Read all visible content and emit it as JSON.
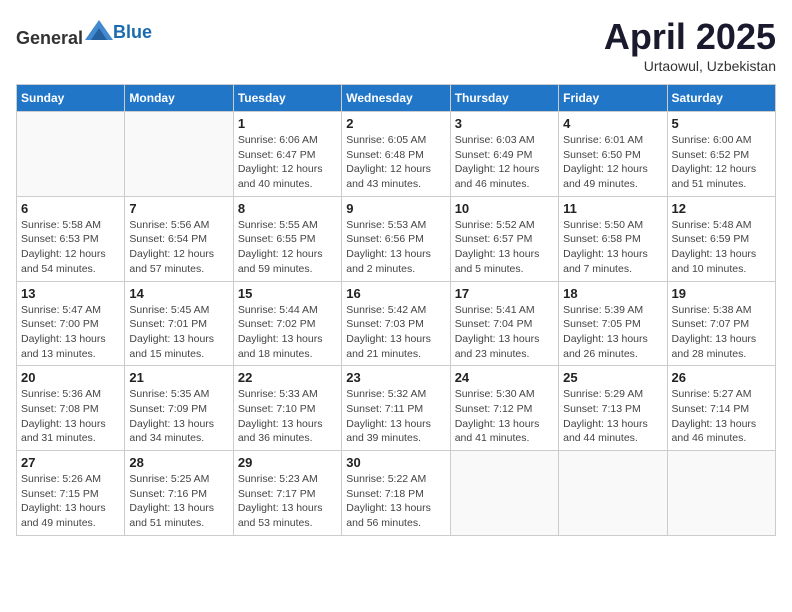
{
  "header": {
    "logo_general": "General",
    "logo_blue": "Blue",
    "month_title": "April 2025",
    "location": "Urtaowul, Uzbekistan"
  },
  "weekdays": [
    "Sunday",
    "Monday",
    "Tuesday",
    "Wednesday",
    "Thursday",
    "Friday",
    "Saturday"
  ],
  "weeks": [
    [
      {
        "day": "",
        "info": ""
      },
      {
        "day": "",
        "info": ""
      },
      {
        "day": "1",
        "info": "Sunrise: 6:06 AM\nSunset: 6:47 PM\nDaylight: 12 hours and 40 minutes."
      },
      {
        "day": "2",
        "info": "Sunrise: 6:05 AM\nSunset: 6:48 PM\nDaylight: 12 hours and 43 minutes."
      },
      {
        "day": "3",
        "info": "Sunrise: 6:03 AM\nSunset: 6:49 PM\nDaylight: 12 hours and 46 minutes."
      },
      {
        "day": "4",
        "info": "Sunrise: 6:01 AM\nSunset: 6:50 PM\nDaylight: 12 hours and 49 minutes."
      },
      {
        "day": "5",
        "info": "Sunrise: 6:00 AM\nSunset: 6:52 PM\nDaylight: 12 hours and 51 minutes."
      }
    ],
    [
      {
        "day": "6",
        "info": "Sunrise: 5:58 AM\nSunset: 6:53 PM\nDaylight: 12 hours and 54 minutes."
      },
      {
        "day": "7",
        "info": "Sunrise: 5:56 AM\nSunset: 6:54 PM\nDaylight: 12 hours and 57 minutes."
      },
      {
        "day": "8",
        "info": "Sunrise: 5:55 AM\nSunset: 6:55 PM\nDaylight: 12 hours and 59 minutes."
      },
      {
        "day": "9",
        "info": "Sunrise: 5:53 AM\nSunset: 6:56 PM\nDaylight: 13 hours and 2 minutes."
      },
      {
        "day": "10",
        "info": "Sunrise: 5:52 AM\nSunset: 6:57 PM\nDaylight: 13 hours and 5 minutes."
      },
      {
        "day": "11",
        "info": "Sunrise: 5:50 AM\nSunset: 6:58 PM\nDaylight: 13 hours and 7 minutes."
      },
      {
        "day": "12",
        "info": "Sunrise: 5:48 AM\nSunset: 6:59 PM\nDaylight: 13 hours and 10 minutes."
      }
    ],
    [
      {
        "day": "13",
        "info": "Sunrise: 5:47 AM\nSunset: 7:00 PM\nDaylight: 13 hours and 13 minutes."
      },
      {
        "day": "14",
        "info": "Sunrise: 5:45 AM\nSunset: 7:01 PM\nDaylight: 13 hours and 15 minutes."
      },
      {
        "day": "15",
        "info": "Sunrise: 5:44 AM\nSunset: 7:02 PM\nDaylight: 13 hours and 18 minutes."
      },
      {
        "day": "16",
        "info": "Sunrise: 5:42 AM\nSunset: 7:03 PM\nDaylight: 13 hours and 21 minutes."
      },
      {
        "day": "17",
        "info": "Sunrise: 5:41 AM\nSunset: 7:04 PM\nDaylight: 13 hours and 23 minutes."
      },
      {
        "day": "18",
        "info": "Sunrise: 5:39 AM\nSunset: 7:05 PM\nDaylight: 13 hours and 26 minutes."
      },
      {
        "day": "19",
        "info": "Sunrise: 5:38 AM\nSunset: 7:07 PM\nDaylight: 13 hours and 28 minutes."
      }
    ],
    [
      {
        "day": "20",
        "info": "Sunrise: 5:36 AM\nSunset: 7:08 PM\nDaylight: 13 hours and 31 minutes."
      },
      {
        "day": "21",
        "info": "Sunrise: 5:35 AM\nSunset: 7:09 PM\nDaylight: 13 hours and 34 minutes."
      },
      {
        "day": "22",
        "info": "Sunrise: 5:33 AM\nSunset: 7:10 PM\nDaylight: 13 hours and 36 minutes."
      },
      {
        "day": "23",
        "info": "Sunrise: 5:32 AM\nSunset: 7:11 PM\nDaylight: 13 hours and 39 minutes."
      },
      {
        "day": "24",
        "info": "Sunrise: 5:30 AM\nSunset: 7:12 PM\nDaylight: 13 hours and 41 minutes."
      },
      {
        "day": "25",
        "info": "Sunrise: 5:29 AM\nSunset: 7:13 PM\nDaylight: 13 hours and 44 minutes."
      },
      {
        "day": "26",
        "info": "Sunrise: 5:27 AM\nSunset: 7:14 PM\nDaylight: 13 hours and 46 minutes."
      }
    ],
    [
      {
        "day": "27",
        "info": "Sunrise: 5:26 AM\nSunset: 7:15 PM\nDaylight: 13 hours and 49 minutes."
      },
      {
        "day": "28",
        "info": "Sunrise: 5:25 AM\nSunset: 7:16 PM\nDaylight: 13 hours and 51 minutes."
      },
      {
        "day": "29",
        "info": "Sunrise: 5:23 AM\nSunset: 7:17 PM\nDaylight: 13 hours and 53 minutes."
      },
      {
        "day": "30",
        "info": "Sunrise: 5:22 AM\nSunset: 7:18 PM\nDaylight: 13 hours and 56 minutes."
      },
      {
        "day": "",
        "info": ""
      },
      {
        "day": "",
        "info": ""
      },
      {
        "day": "",
        "info": ""
      }
    ]
  ]
}
